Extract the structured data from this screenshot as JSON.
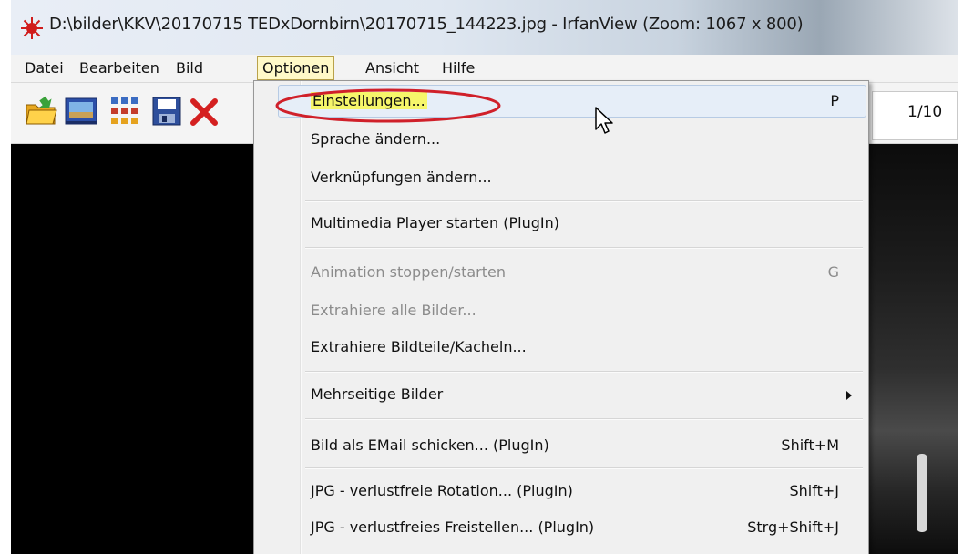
{
  "window": {
    "title": "D:\\bilder\\KKV\\20170715 TEDxDornbirn\\20170715_144223.jpg - IrfanView (Zoom: 1067 x 800)",
    "app_icon": "irfanview-icon"
  },
  "menubar": {
    "items": [
      "Datei",
      "Bearbeiten",
      "Bild",
      "Optionen",
      "Ansicht",
      "Hilfe"
    ],
    "active": "Optionen"
  },
  "toolbar": {
    "icons": [
      "open-folder-icon",
      "slideshow-icon",
      "thumbnails-icon",
      "save-icon",
      "delete-icon"
    ],
    "page_counter": "1/10"
  },
  "dropdown": {
    "items": [
      {
        "label": "Einstellungen...",
        "shortcut": "P",
        "hovered": true,
        "highlighted": true
      },
      {
        "label": "Sprache ändern...",
        "shortcut": ""
      },
      {
        "label": "Verknüpfungen ändern...",
        "shortcut": ""
      },
      {
        "label": "Multimedia Player starten (PlugIn)",
        "shortcut": ""
      },
      {
        "label": "Animation stoppen/starten",
        "shortcut": "G",
        "disabled": true
      },
      {
        "label": "Extrahiere alle Bilder...",
        "shortcut": "",
        "disabled": true
      },
      {
        "label": "Extrahiere Bildteile/Kacheln...",
        "shortcut": ""
      },
      {
        "label": "Mehrseitige Bilder",
        "shortcut": "",
        "submenu": true
      },
      {
        "label": "Bild als EMail schicken... (PlugIn)",
        "shortcut": "Shift+M"
      },
      {
        "label": "JPG - verlustfreie Rotation... (PlugIn)",
        "shortcut": "Shift+J"
      },
      {
        "label": "JPG - verlustfreies Freistellen... (PlugIn)",
        "shortcut": "Strg+Shift+J"
      }
    ]
  },
  "colors": {
    "highlight": "#f6f66a",
    "annotation": "#d0202a",
    "menu_active_bg": "#fff9c8"
  }
}
